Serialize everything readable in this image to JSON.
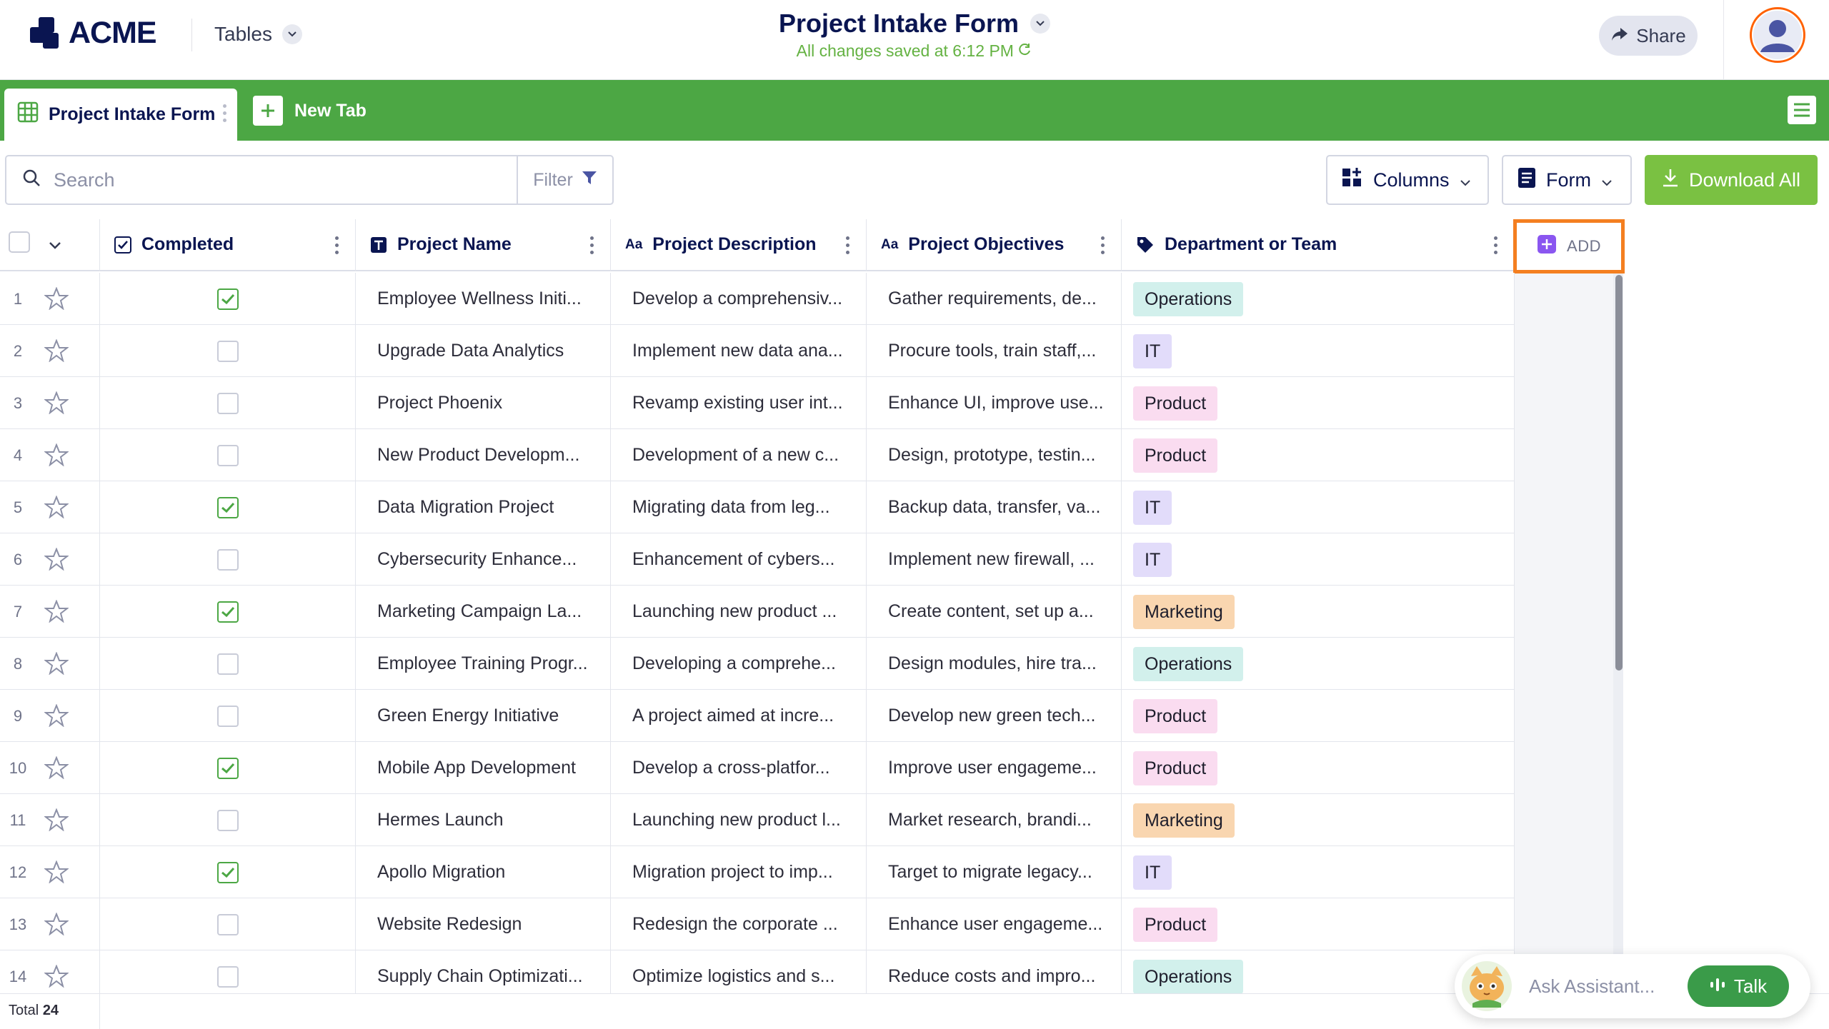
{
  "header": {
    "logo_text": "ACME",
    "tables_label": "Tables",
    "title": "Project Intake Form",
    "save_status": "All changes saved at 6:12 PM",
    "share_label": "Share"
  },
  "tabs": {
    "active_label": "Project Intake Form",
    "new_tab_label": "New Tab"
  },
  "toolbar": {
    "search_placeholder": "Search",
    "filter_label": "Filter",
    "columns_label": "Columns",
    "form_label": "Form",
    "download_label": "Download All"
  },
  "columns": {
    "completed": "Completed",
    "project_name": "Project Name",
    "project_description": "Project Description",
    "project_objectives": "Project Objectives",
    "department": "Department or Team",
    "add_label": "ADD"
  },
  "rows": [
    {
      "num": "1",
      "completed": true,
      "name": "Employee Wellness Initi...",
      "description": "Develop a comprehensiv...",
      "objectives": "Gather requirements, de...",
      "department": "Operations"
    },
    {
      "num": "2",
      "completed": false,
      "name": "Upgrade Data Analytics",
      "description": "Implement new data ana...",
      "objectives": "Procure tools, train staff,...",
      "department": "IT"
    },
    {
      "num": "3",
      "completed": false,
      "name": "Project Phoenix",
      "description": "Revamp existing user int...",
      "objectives": "Enhance UI, improve use...",
      "department": "Product"
    },
    {
      "num": "4",
      "completed": false,
      "name": "New Product Developm...",
      "description": "Development of a new c...",
      "objectives": "Design, prototype, testin...",
      "department": "Product"
    },
    {
      "num": "5",
      "completed": true,
      "name": "Data Migration Project",
      "description": "Migrating data from leg...",
      "objectives": "Backup data, transfer, va...",
      "department": "IT"
    },
    {
      "num": "6",
      "completed": false,
      "name": "Cybersecurity Enhance...",
      "description": "Enhancement of cybers...",
      "objectives": "Implement new firewall, ...",
      "department": "IT"
    },
    {
      "num": "7",
      "completed": true,
      "name": "Marketing Campaign La...",
      "description": "Launching new product ...",
      "objectives": "Create content, set up a...",
      "department": "Marketing"
    },
    {
      "num": "8",
      "completed": false,
      "name": "Employee Training Progr...",
      "description": "Developing a comprehe...",
      "objectives": "Design modules, hire tra...",
      "department": "Operations"
    },
    {
      "num": "9",
      "completed": false,
      "name": "Green Energy Initiative",
      "description": "A project aimed at incre...",
      "objectives": "Develop new green tech...",
      "department": "Product"
    },
    {
      "num": "10",
      "completed": true,
      "name": "Mobile App Development",
      "description": "Develop a cross-platfor...",
      "objectives": "Improve user engageme...",
      "department": "Product"
    },
    {
      "num": "11",
      "completed": false,
      "name": "Hermes Launch",
      "description": "Launching new product l...",
      "objectives": "Market research, brandi...",
      "department": "Marketing"
    },
    {
      "num": "12",
      "completed": true,
      "name": "Apollo Migration",
      "description": "Migration project to imp...",
      "objectives": "Target to migrate legacy...",
      "department": "IT"
    },
    {
      "num": "13",
      "completed": false,
      "name": "Website Redesign",
      "description": "Redesign the corporate ...",
      "objectives": "Enhance user engageme...",
      "department": "Product"
    },
    {
      "num": "14",
      "completed": false,
      "name": "Supply Chain Optimizati...",
      "description": "Optimize logistics and s...",
      "objectives": "Reduce costs and impro...",
      "department": "Operations"
    }
  ],
  "department_colors": {
    "Operations": "#d2f0ec",
    "IT": "#e2dcfa",
    "Product": "#fadcf0",
    "Marketing": "#f9d6b0"
  },
  "footer": {
    "total_label": "Total",
    "total_count": "24"
  },
  "assistant": {
    "placeholder": "Ask Assistant...",
    "talk_label": "Talk"
  },
  "colors": {
    "brand_navy": "#0a1551",
    "tab_bar_green": "#4ca744",
    "download_green": "#7ac142",
    "add_highlight": "#f47f20",
    "saved_green": "#64b242"
  }
}
